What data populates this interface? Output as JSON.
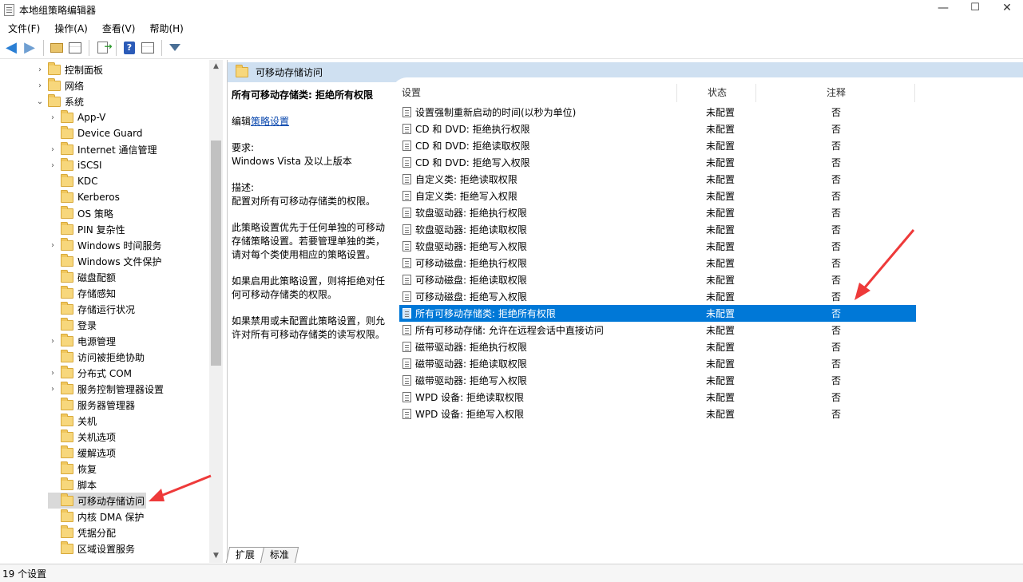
{
  "window": {
    "title": "本地组策略编辑器"
  },
  "window_controls": {
    "minimize": "—",
    "maximize": "☐",
    "close": "✕"
  },
  "menu": [
    "文件(F)",
    "操作(A)",
    "查看(V)",
    "帮助(H)"
  ],
  "toolbar": {
    "icons": [
      "back-arrow-icon",
      "forward-arrow-icon",
      "up-folder-icon",
      "show-hide-tree-icon",
      "export-list-icon",
      "help-icon",
      "properties-icon",
      "filter-icon"
    ],
    "help_glyph": "?"
  },
  "tree": {
    "items": [
      {
        "label": "控制面板",
        "expand": "›"
      },
      {
        "label": "网络",
        "expand": "›"
      },
      {
        "label": "系统",
        "expand": "⌄"
      },
      {
        "label": "App-V",
        "expand": "›"
      },
      {
        "label": "Device Guard",
        "expand": ""
      },
      {
        "label": "Internet 通信管理",
        "expand": "›"
      },
      {
        "label": "iSCSI",
        "expand": "›"
      },
      {
        "label": "KDC",
        "expand": ""
      },
      {
        "label": "Kerberos",
        "expand": ""
      },
      {
        "label": "OS 策略",
        "expand": ""
      },
      {
        "label": "PIN 复杂性",
        "expand": ""
      },
      {
        "label": "Windows 时间服务",
        "expand": "›"
      },
      {
        "label": "Windows 文件保护",
        "expand": ""
      },
      {
        "label": "磁盘配额",
        "expand": ""
      },
      {
        "label": "存储感知",
        "expand": ""
      },
      {
        "label": "存储运行状况",
        "expand": ""
      },
      {
        "label": "登录",
        "expand": ""
      },
      {
        "label": "电源管理",
        "expand": "›"
      },
      {
        "label": "访问被拒绝协助",
        "expand": ""
      },
      {
        "label": "分布式 COM",
        "expand": "›"
      },
      {
        "label": "服务控制管理器设置",
        "expand": "›"
      },
      {
        "label": "服务器管理器",
        "expand": ""
      },
      {
        "label": "关机",
        "expand": ""
      },
      {
        "label": "关机选项",
        "expand": ""
      },
      {
        "label": "缓解选项",
        "expand": ""
      },
      {
        "label": "恢复",
        "expand": ""
      },
      {
        "label": "脚本",
        "expand": ""
      },
      {
        "label": "可移动存储访问",
        "expand": ""
      },
      {
        "label": "内核 DMA 保护",
        "expand": ""
      },
      {
        "label": "凭据分配",
        "expand": ""
      },
      {
        "label": "区域设置服务",
        "expand": ""
      }
    ],
    "selected": "可移动存储访问",
    "scroll_up": "▲",
    "scroll_down": "▼"
  },
  "panel": {
    "header": "可移动存储访问"
  },
  "description": {
    "title": "所有可移动存储类: 拒绝所有权限",
    "edit_prefix": "编辑",
    "edit_link": "策略设置",
    "requirements_label": "要求:",
    "requirements": "Windows Vista 及以上版本",
    "description_label": "描述:",
    "description": "配置对所有可移动存储类的权限。",
    "para1": "此策略设置优先于任何单独的可移动存储策略设置。若要管理单独的类，请对每个类使用相应的策略设置。",
    "para2": "如果启用此策略设置，则将拒绝对任何可移动存储类的权限。",
    "para3": "如果禁用或未配置此策略设置，则允许对所有可移动存储类的读写权限。"
  },
  "list": {
    "columns": [
      "设置",
      "状态",
      "注释"
    ],
    "rows": [
      {
        "name": "设置强制重新启动的时间(以秒为单位)",
        "state": "未配置",
        "note": "否"
      },
      {
        "name": "CD 和 DVD: 拒绝执行权限",
        "state": "未配置",
        "note": "否"
      },
      {
        "name": "CD 和 DVD: 拒绝读取权限",
        "state": "未配置",
        "note": "否"
      },
      {
        "name": "CD 和 DVD: 拒绝写入权限",
        "state": "未配置",
        "note": "否"
      },
      {
        "name": "自定义类: 拒绝读取权限",
        "state": "未配置",
        "note": "否"
      },
      {
        "name": "自定义类: 拒绝写入权限",
        "state": "未配置",
        "note": "否"
      },
      {
        "name": "软盘驱动器: 拒绝执行权限",
        "state": "未配置",
        "note": "否"
      },
      {
        "name": "软盘驱动器: 拒绝读取权限",
        "state": "未配置",
        "note": "否"
      },
      {
        "name": "软盘驱动器: 拒绝写入权限",
        "state": "未配置",
        "note": "否"
      },
      {
        "name": "可移动磁盘: 拒绝执行权限",
        "state": "未配置",
        "note": "否"
      },
      {
        "name": "可移动磁盘: 拒绝读取权限",
        "state": "未配置",
        "note": "否"
      },
      {
        "name": "可移动磁盘: 拒绝写入权限",
        "state": "未配置",
        "note": "否"
      },
      {
        "name": "所有可移动存储类: 拒绝所有权限",
        "state": "未配置",
        "note": "否"
      },
      {
        "name": "所有可移动存储: 允许在远程会话中直接访问",
        "state": "未配置",
        "note": "否"
      },
      {
        "name": "磁带驱动器: 拒绝执行权限",
        "state": "未配置",
        "note": "否"
      },
      {
        "name": "磁带驱动器: 拒绝读取权限",
        "state": "未配置",
        "note": "否"
      },
      {
        "name": "磁带驱动器: 拒绝写入权限",
        "state": "未配置",
        "note": "否"
      },
      {
        "name": "WPD 设备: 拒绝读取权限",
        "state": "未配置",
        "note": "否"
      },
      {
        "name": "WPD 设备: 拒绝写入权限",
        "state": "未配置",
        "note": "否"
      }
    ],
    "selected_index": 12
  },
  "tabs": [
    "扩展",
    "标准"
  ],
  "status": {
    "text": "19 个设置"
  },
  "colors": {
    "selection": "#0078d7",
    "header": "#cfe0f1",
    "annotation": "#ee3a3a"
  }
}
